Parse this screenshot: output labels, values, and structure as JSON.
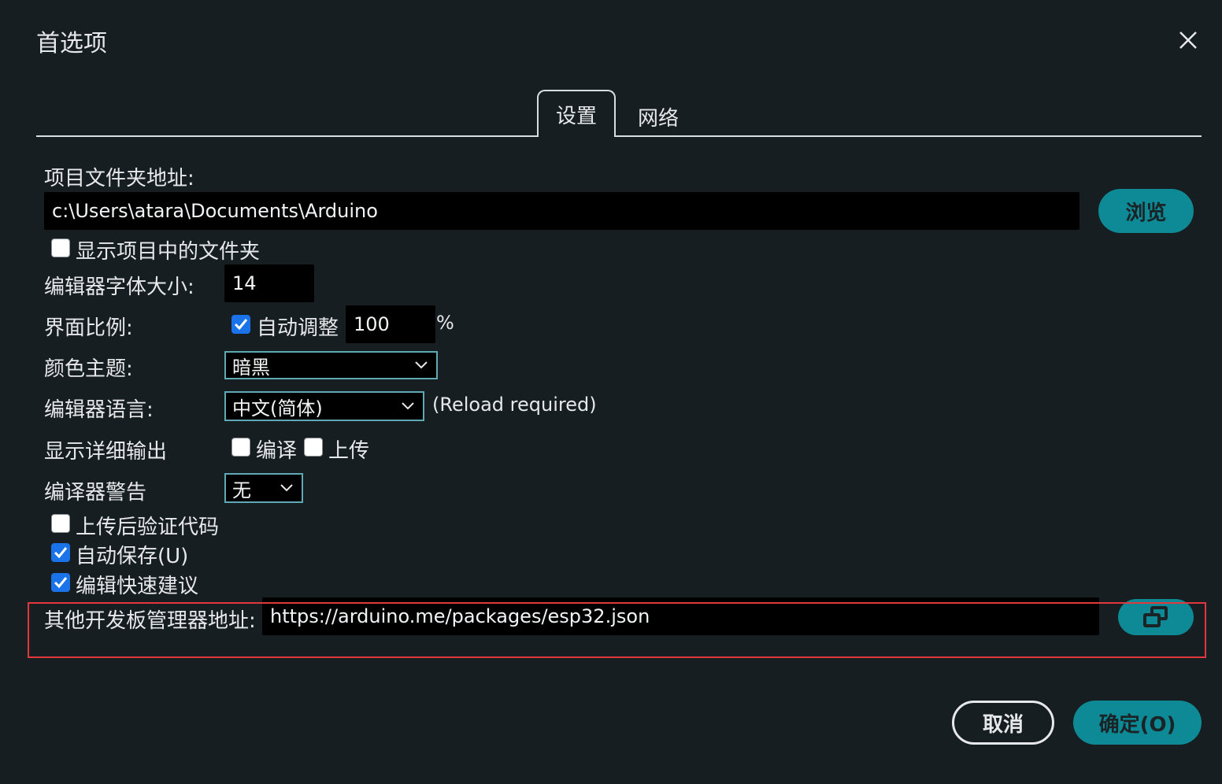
{
  "dialog": {
    "title": "首选项",
    "close_icon": "close-icon"
  },
  "tabs": [
    {
      "label": "设置",
      "active": true
    },
    {
      "label": "网络",
      "active": false
    }
  ],
  "sketchbook": {
    "label": "项目文件夹地址:",
    "value": "c:\\Users\\atara\\Documents\\Arduino",
    "browse_label": "浏览"
  },
  "show_files": {
    "label": "显示项目中的文件夹",
    "checked": false
  },
  "font_size": {
    "label": "编辑器字体大小:",
    "value": "14"
  },
  "scale": {
    "label": "界面比例:",
    "auto_label": "自动调整",
    "auto_checked": true,
    "value": "100",
    "unit": "%"
  },
  "theme": {
    "label": "颜色主题:",
    "value": "暗黑"
  },
  "language": {
    "label": "编辑器语言:",
    "value": "中文(简体)",
    "note": "(Reload required)"
  },
  "verbose": {
    "label": "显示详细输出",
    "compile_label": "编译",
    "compile_checked": false,
    "upload_label": "上传",
    "upload_checked": false
  },
  "warnings": {
    "label": "编译器警告",
    "value": "无"
  },
  "options": [
    {
      "label": "上传后验证代码",
      "checked": false
    },
    {
      "label": "自动保存(U)",
      "checked": true
    },
    {
      "label": "编辑快速建议",
      "checked": true
    }
  ],
  "board_urls": {
    "label": "其他开发板管理器地址:",
    "value": "https://arduino.me/packages/esp32.json",
    "button_icon": "open-window-icon"
  },
  "footer": {
    "cancel_label": "取消",
    "ok_label": "确定(O)"
  },
  "colors": {
    "background": "#171e21",
    "accent": "#0e8a96",
    "highlight": "#e0383d",
    "checkbox_checked": "#1a73e8"
  }
}
